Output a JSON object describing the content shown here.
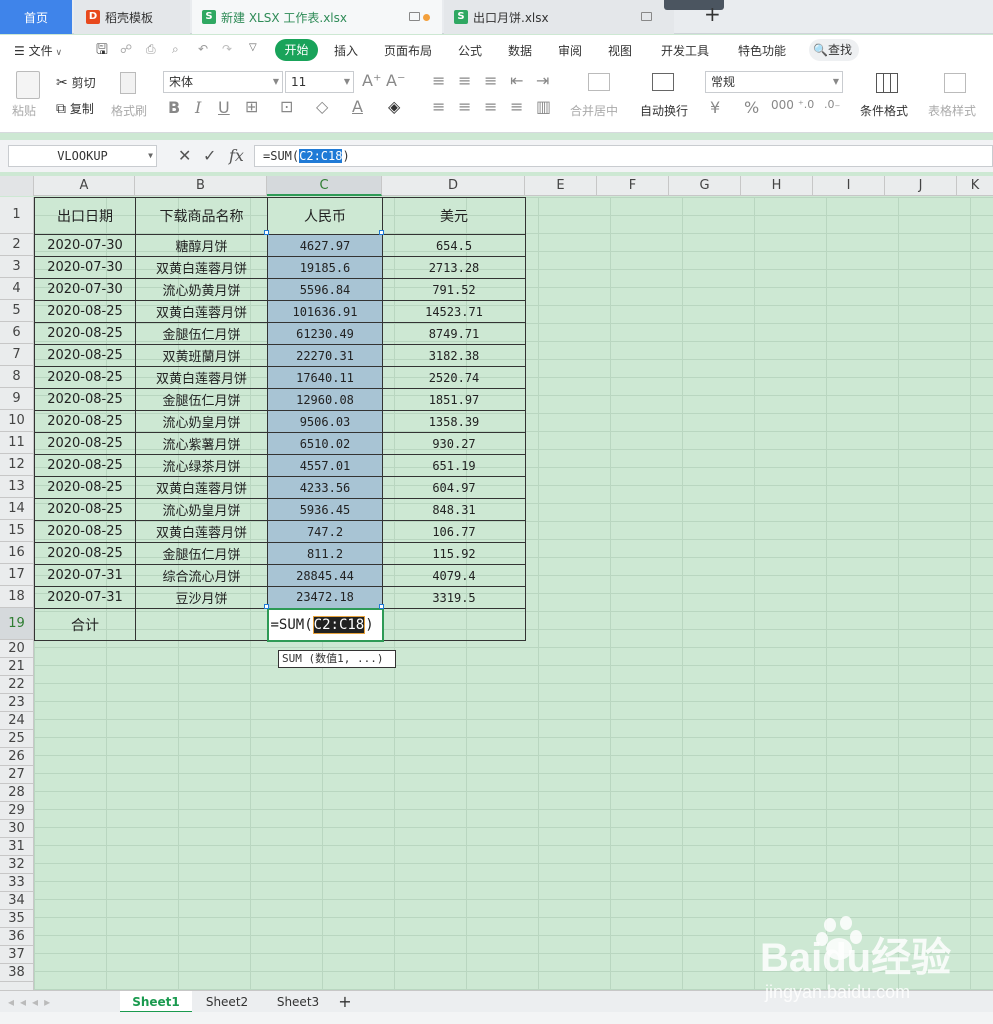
{
  "tabs": {
    "home": "首页",
    "template": "稻壳模板",
    "doc1": "新建 XLSX 工作表.xlsx",
    "doc2": "出口月饼.xlsx",
    "new_tab": "+"
  },
  "menu": {
    "file": "文件",
    "start": "开始",
    "insert": "插入",
    "layout": "页面布局",
    "formula": "公式",
    "data": "数据",
    "review": "审阅",
    "view": "视图",
    "dev": "开发工具",
    "special": "特色功能",
    "search": "查找"
  },
  "ribbon": {
    "cut": "剪切",
    "paste": "粘贴",
    "copy": "复制",
    "format_painter": "格式刷",
    "font": "宋体",
    "size": "11",
    "merge": "合并居中",
    "wrap": "自动换行",
    "num_format": "常规",
    "cond_format": "条件格式",
    "table_style": "表格样式"
  },
  "formula_bar": {
    "name_box": "VLOOKUP",
    "cancel": "✕",
    "confirm": "✓",
    "fx": "fx",
    "formula_prefix": "=SUM(",
    "formula_range": "C2:C18",
    "formula_suffix": ")"
  },
  "columns": [
    "A",
    "B",
    "C",
    "D",
    "E",
    "F",
    "G",
    "H",
    "I",
    "J",
    "K"
  ],
  "rows": [
    "1",
    "2",
    "3",
    "4",
    "5",
    "6",
    "7",
    "8",
    "9",
    "10",
    "11",
    "12",
    "13",
    "14",
    "15",
    "16",
    "17",
    "18",
    "19",
    "20",
    "21",
    "22",
    "23",
    "24",
    "25",
    "26",
    "27",
    "28",
    "29",
    "30",
    "31",
    "32",
    "33",
    "34",
    "35",
    "36",
    "37",
    "38"
  ],
  "table": {
    "headers": [
      "出口日期",
      "下载商品名称",
      "人民币",
      "美元"
    ],
    "rows": [
      [
        "2020-07-30",
        "糖醇月饼",
        "4627.97",
        "654.5"
      ],
      [
        "2020-07-30",
        "双黄白莲蓉月饼",
        "19185.6",
        "2713.28"
      ],
      [
        "2020-07-30",
        "流心奶黄月饼",
        "5596.84",
        "791.52"
      ],
      [
        "2020-08-25",
        "双黄白莲蓉月饼",
        "101636.91",
        "14523.71"
      ],
      [
        "2020-08-25",
        "金腿伍仁月饼",
        "61230.49",
        "8749.71"
      ],
      [
        "2020-08-25",
        "双黄班蘭月饼",
        "22270.31",
        "3182.38"
      ],
      [
        "2020-08-25",
        "双黄白莲蓉月饼",
        "17640.11",
        "2520.74"
      ],
      [
        "2020-08-25",
        "金腿伍仁月饼",
        "12960.08",
        "1851.97"
      ],
      [
        "2020-08-25",
        "流心奶皇月饼",
        "9506.03",
        "1358.39"
      ],
      [
        "2020-08-25",
        "流心紫薯月饼",
        "6510.02",
        "930.27"
      ],
      [
        "2020-08-25",
        "流心绿茶月饼",
        "4557.01",
        "651.19"
      ],
      [
        "2020-08-25",
        "双黄白莲蓉月饼",
        "4233.56",
        "604.97"
      ],
      [
        "2020-08-25",
        "流心奶皇月饼",
        "5936.45",
        "848.31"
      ],
      [
        "2020-08-25",
        "双黄白莲蓉月饼",
        "747.2",
        "106.77"
      ],
      [
        "2020-08-25",
        "金腿伍仁月饼",
        "811.2",
        "115.92"
      ],
      [
        "2020-07-31",
        "综合流心月饼",
        "28845.44",
        "4079.4"
      ],
      [
        "2020-07-31",
        "豆沙月饼",
        "23472.18",
        "3319.5"
      ]
    ],
    "total_label": "合计",
    "edit_prefix": "=SUM(",
    "edit_range": "C2:C18",
    "edit_suffix": ")"
  },
  "tooltip": "SUM (数值1, ...)",
  "sheets": [
    "Sheet1",
    "Sheet2",
    "Sheet3"
  ],
  "add_sheet": "+",
  "watermark": {
    "brand": "Baidu经验",
    "url": "jingyan.baidu.com"
  }
}
